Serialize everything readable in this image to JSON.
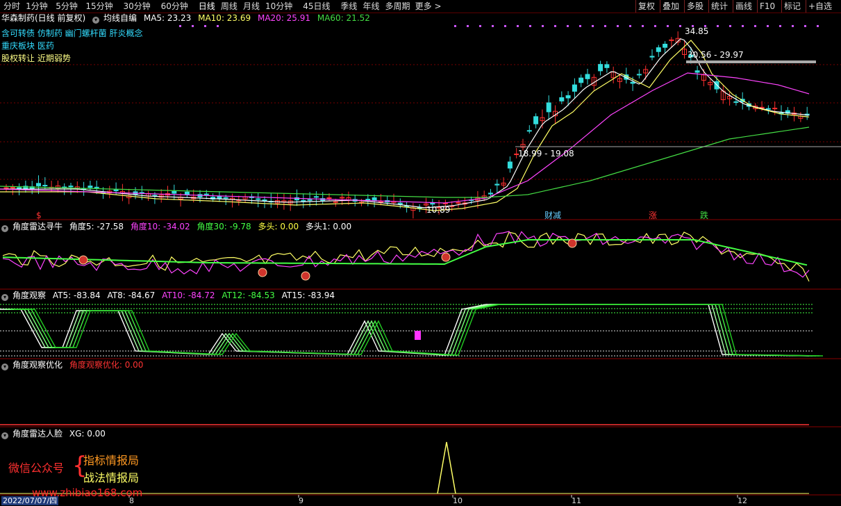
{
  "toolbar": {
    "periods": [
      "分时",
      "1分钟",
      "5分钟",
      "15分钟",
      "30分钟",
      "60分钟",
      "日线",
      "周线",
      "月线",
      "10分钟",
      "45日线",
      "季线",
      "年线",
      "多周期",
      "更多 >"
    ],
    "active": "日线",
    "right": [
      "复权",
      "叠加",
      "多股",
      "统计",
      "画线",
      "F10",
      "标记",
      "+自选"
    ]
  },
  "main_pane": {
    "stock": "华森制药(日线 前复权)",
    "indicator": "均线自编",
    "ma": [
      {
        "label": "MA5: 23.23",
        "color": "#ffffff"
      },
      {
        "label": "MA10: 23.69",
        "color": "#ffff66"
      },
      {
        "label": "MA20: 25.91",
        "color": "#ff44ff"
      },
      {
        "label": "MA60: 21.52",
        "color": "#44dd44"
      }
    ],
    "concepts": [
      "含可转债 仿制药 幽门螺杆菌 肝炎概念",
      "重庆板块  医药",
      "股权转让 近期弱势"
    ],
    "annotations": {
      "high": "34.85",
      "range_high": "30.56 - 29.97",
      "range_low": "18.99 - 19.08",
      "low": "10.89"
    },
    "markers": [
      {
        "label": "$",
        "color": "#ff3333"
      },
      {
        "label": "财减",
        "color": "#66ccff"
      },
      {
        "label": "涨",
        "color": "#ff3333"
      },
      {
        "label": "跌",
        "color": "#44dd44"
      }
    ]
  },
  "pane2": {
    "name": "角度雷达寻牛",
    "items": [
      {
        "label": "角度5: -27.58",
        "color": "#ffffff"
      },
      {
        "label": "角度10: -34.02",
        "color": "#ff44ff"
      },
      {
        "label": "角度30: -9.78",
        "color": "#44ff44"
      },
      {
        "label": "多头: 0.00",
        "color": "#ffff44"
      },
      {
        "label": "多头1: 0.00",
        "color": "#ffffff"
      }
    ]
  },
  "pane3": {
    "name": "角度观察",
    "items": [
      {
        "label": "AT5: -83.84",
        "color": "#ffffff"
      },
      {
        "label": "AT8: -84.67",
        "color": "#ffffff"
      },
      {
        "label": "AT10: -84.72",
        "color": "#ff44ff"
      },
      {
        "label": "AT12: -84.53",
        "color": "#44ff44"
      },
      {
        "label": "AT15: -83.94",
        "color": "#ffffff"
      }
    ]
  },
  "pane4": {
    "name": "角度观察优化",
    "items": [
      {
        "label": "角度观察优化: 0.00",
        "color": "#ff3333"
      }
    ]
  },
  "pane5": {
    "name": "角度雷达人脸",
    "items": [
      {
        "label": "XG: 0.00",
        "color": "#ffffff"
      }
    ]
  },
  "watermark": {
    "left": "微信公众号",
    "right1": "指标情报局",
    "right2": "战法情报局",
    "site": "www.zhibiao168.com"
  },
  "date_axis": {
    "current": "2022/07/07/四",
    "months": [
      "8",
      "9",
      "10",
      "11",
      "12"
    ]
  },
  "colors": {
    "up": "#ff3030",
    "down": "#33dddd",
    "grid": "#7a0000",
    "ma5": "#ffffff",
    "ma10": "#ffff66",
    "ma20": "#ff44ff",
    "ma60": "#44dd44"
  }
}
